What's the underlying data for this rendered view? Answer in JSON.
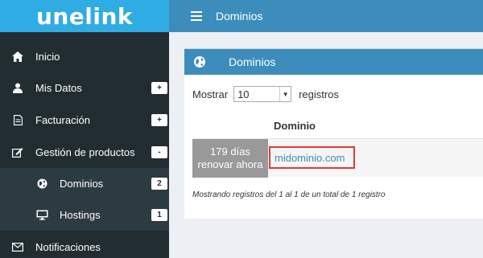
{
  "brand": {
    "logo": "unelink"
  },
  "sidebar": {
    "items": [
      {
        "label": "Inicio",
        "icon": "home-icon"
      },
      {
        "label": "Mis Datos",
        "icon": "user-icon",
        "badge": "+"
      },
      {
        "label": "Facturación",
        "icon": "document-icon",
        "badge": "+"
      },
      {
        "label": "Gestión de productos",
        "icon": "edit-icon",
        "badge": "-"
      },
      {
        "label": "Dominios",
        "icon": "globe-icon",
        "badge": "2"
      },
      {
        "label": "Hostings",
        "icon": "monitor-icon",
        "badge": "1"
      },
      {
        "label": "Notificaciones",
        "icon": "envelope-icon"
      }
    ]
  },
  "header": {
    "title": "Dominios",
    "menu_icon": "hamburger-icon"
  },
  "box": {
    "title": "Dominios",
    "icon": "globe-icon",
    "length_prefix": "Mostrar",
    "length_value": "10",
    "length_suffix": "registros",
    "column_header": "Dominio",
    "rows": [
      {
        "days": "179 días",
        "renew": "renovar ahora",
        "domain": "midominio.com"
      }
    ],
    "info": "Mostrando registros del 1 al 1 de un total de 1 registro"
  },
  "colors": {
    "sidebar_bg": "#222d32",
    "logo_bg": "#2eace3",
    "header_bg": "#3c8dbc",
    "highlight_border": "#e53935",
    "expiry_bg": "#999999"
  }
}
